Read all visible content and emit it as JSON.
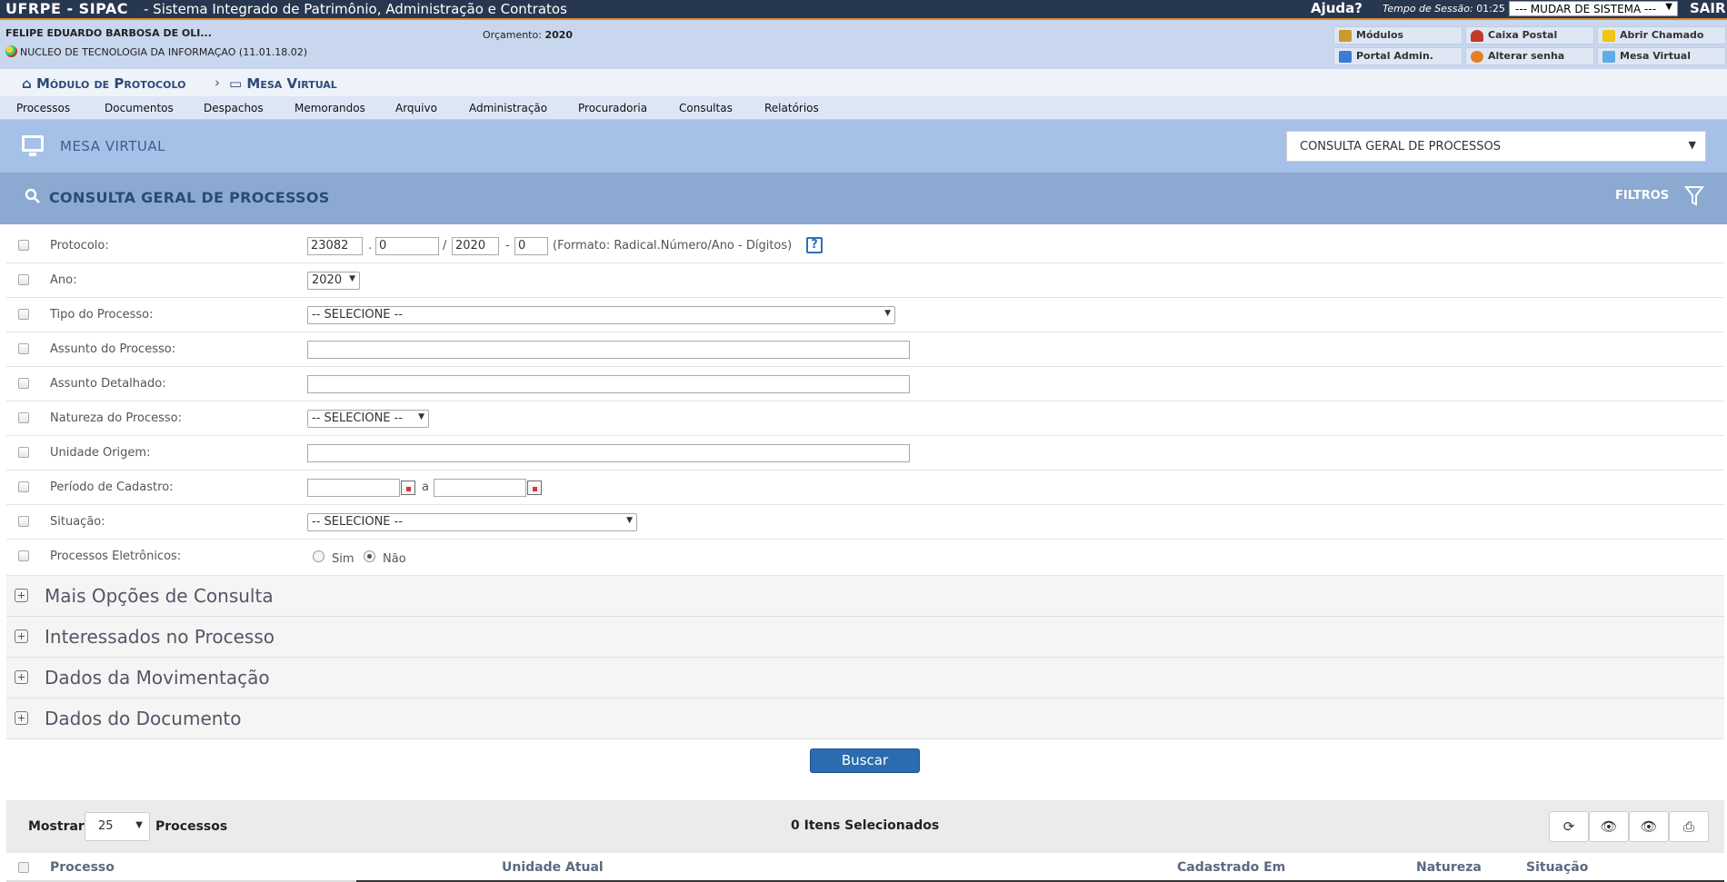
{
  "topbar": {
    "brand": "UFRPE - SIPAC",
    "system_name": "- Sistema Integrado de Patrimônio, Administração e Contratos",
    "help": "Ajuda?",
    "session_label": "Tempo de Sessão:",
    "session_time": "01:25",
    "system_select": "--- MUDAR DE SISTEMA ---",
    "logout": "SAIR"
  },
  "user": {
    "name": "FELIPE EDUARDO BARBOSA DE OLI...",
    "unit": "NUCLEO DE TECNOLOGIA DA INFORMAÇAO (11.01.18.02)",
    "budget_label": "Orçamento:",
    "budget_year": "2020"
  },
  "quick_links": {
    "modulos": "Módulos",
    "caixa_postal": "Caixa Postal",
    "abrir_chamado": "Abrir Chamado",
    "portal_admin": "Portal Admin.",
    "alterar_senha": "Alterar senha",
    "mesa_virtual": "Mesa Virtual"
  },
  "breadcrumb": {
    "module": "Módulo de Protocolo",
    "separator": "›",
    "current": "Mesa Virtual"
  },
  "menu": [
    "Processos",
    "Documentos",
    "Despachos",
    "Memorandos",
    "Arquivo",
    "Administração",
    "Procuradoria",
    "Consultas",
    "Relatórios"
  ],
  "mesa": {
    "title": "MESA VIRTUAL",
    "view_select": "CONSULTA GERAL DE PROCESSOS"
  },
  "consulta": {
    "title": "CONSULTA GERAL DE PROCESSOS",
    "filters": "FILTROS"
  },
  "form": {
    "protocolo": {
      "label": "Protocolo:",
      "radical": "23082",
      "numero": "0",
      "ano": "2020",
      "digitos": "0",
      "dot": ".",
      "slash": "/",
      "dash": "-",
      "format_hint": "(Formato: Radical.Número/Ano - Dígitos)",
      "help": "?"
    },
    "ano": {
      "label": "Ano:",
      "value": "2020"
    },
    "tipo": {
      "label": "Tipo do Processo:",
      "value": "-- SELECIONE --"
    },
    "assunto": {
      "label": "Assunto do Processo:",
      "value": ""
    },
    "assunto_detalhado": {
      "label": "Assunto Detalhado:",
      "value": ""
    },
    "natureza": {
      "label": "Natureza do Processo:",
      "value": "-- SELECIONE --"
    },
    "unidade_origem": {
      "label": "Unidade Origem:",
      "value": ""
    },
    "periodo": {
      "label": "Período de Cadastro:",
      "from": "",
      "to": "",
      "sep": "a"
    },
    "situacao": {
      "label": "Situação:",
      "value": "-- SELECIONE --"
    },
    "eletronicos": {
      "label": "Processos Eletrônicos:",
      "sim": "Sim",
      "nao": "Não",
      "selected": "Não"
    }
  },
  "sections": [
    "Mais Opções de Consulta",
    "Interessados no Processo",
    "Dados da Movimentação",
    "Dados do Documento"
  ],
  "search_button": "Buscar",
  "results": {
    "show_label": "Mostrar",
    "page_size": "25",
    "items_label": "Processos",
    "selected_count": "0 Itens Selecionados",
    "columns": [
      "Processo",
      "Unidade Atual",
      "Cadastrado Em",
      "Natureza",
      "Situação"
    ]
  }
}
